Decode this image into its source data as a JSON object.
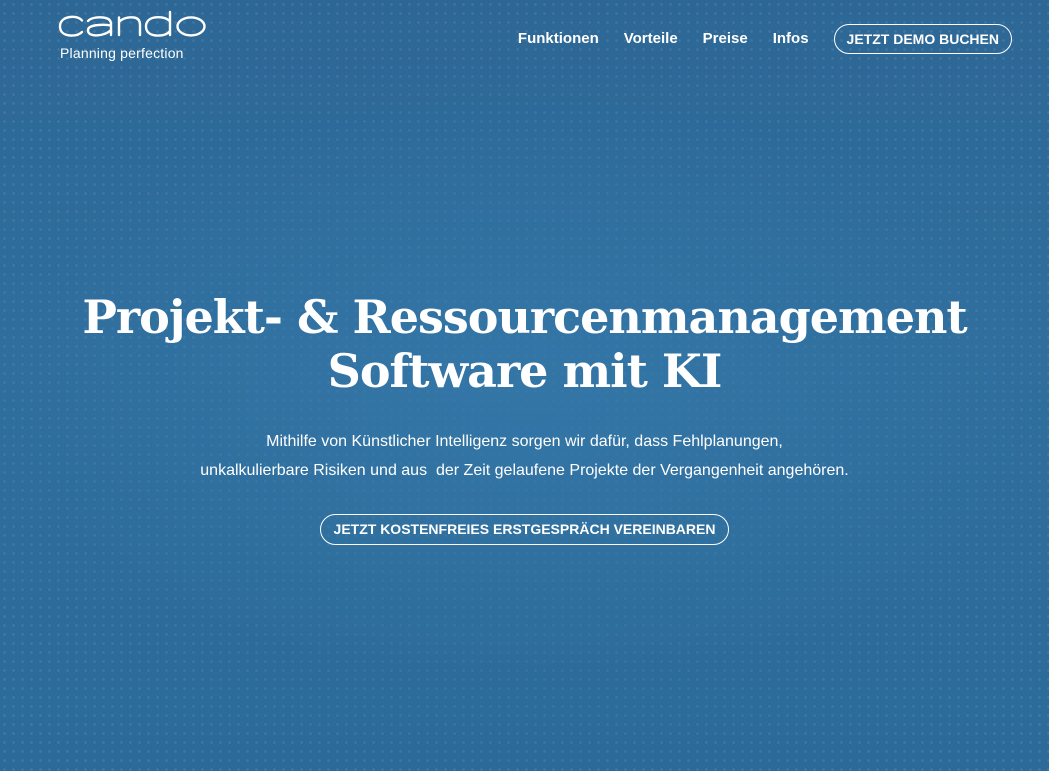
{
  "brand": {
    "logo_text": "cando",
    "tagline": "Planning perfection"
  },
  "nav": {
    "items": [
      {
        "label": "Funktionen"
      },
      {
        "label": "Vorteile"
      },
      {
        "label": "Preise"
      },
      {
        "label": "Infos"
      }
    ],
    "cta_label": "JETZT DEMO BUCHEN"
  },
  "hero": {
    "headline_line1": "Projekt- & Ressourcenmanagement",
    "headline_line2": "Software mit KI",
    "subtext_line1": "Mithilfe von Künstlicher Intelligenz sorgen wir dafür, dass Fehlplanungen,",
    "subtext_line2": "unkalkulierbare Risiken und aus  der Zeit gelaufene Projekte der Vergangenheit angehören.",
    "cta_label": "JETZT KOSTENFREIES ERSTGESPRÄCH VEREINBAREN"
  },
  "colors": {
    "background": "#2d6a98",
    "text": "#ffffff"
  }
}
